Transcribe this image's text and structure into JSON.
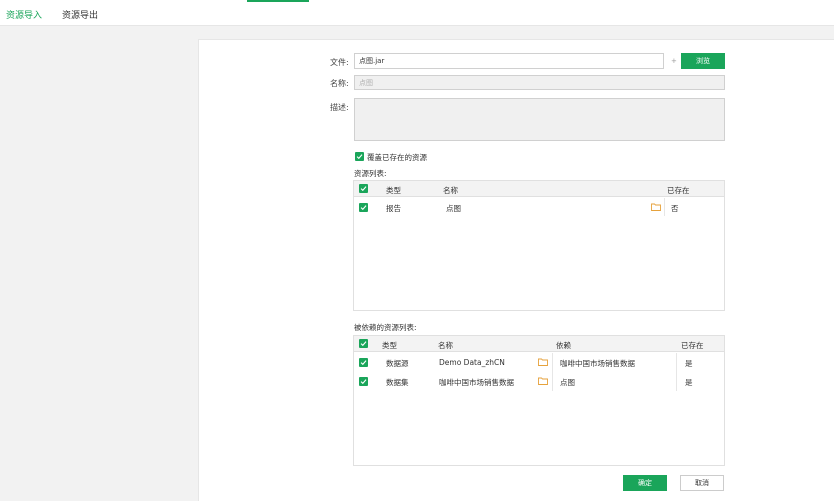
{
  "tabs": [
    "资源导入",
    "资源导出"
  ],
  "form": {
    "file_label": "文件:",
    "file_value": "点图.jar",
    "plus": "+",
    "browse_label": "浏览",
    "name_label": "名称:",
    "name_placeholder": "点图",
    "desc_label": "描述:",
    "overwrite_label": "覆盖已存在的资源"
  },
  "resources": {
    "title": "资源列表:",
    "headers": [
      "类型",
      "名称",
      "已存在"
    ],
    "rows": [
      {
        "type": "报告",
        "name": "点图",
        "exists": "否"
      }
    ]
  },
  "dependencies": {
    "title": "被依赖的资源列表:",
    "headers": [
      "类型",
      "名称",
      "依赖",
      "已存在"
    ],
    "rows": [
      {
        "type": "数据源",
        "name": "Demo Data_zhCN",
        "dep": "咖啡中国市场销售数据",
        "exists": "是"
      },
      {
        "type": "数据集",
        "name": "咖啡中国市场销售数据",
        "dep": "点图",
        "exists": "是"
      }
    ]
  },
  "footer": {
    "ok_label": "确定",
    "cancel_label": "取消"
  },
  "colors": {
    "accent": "#1aa55a",
    "folder": "#e6a23c"
  }
}
